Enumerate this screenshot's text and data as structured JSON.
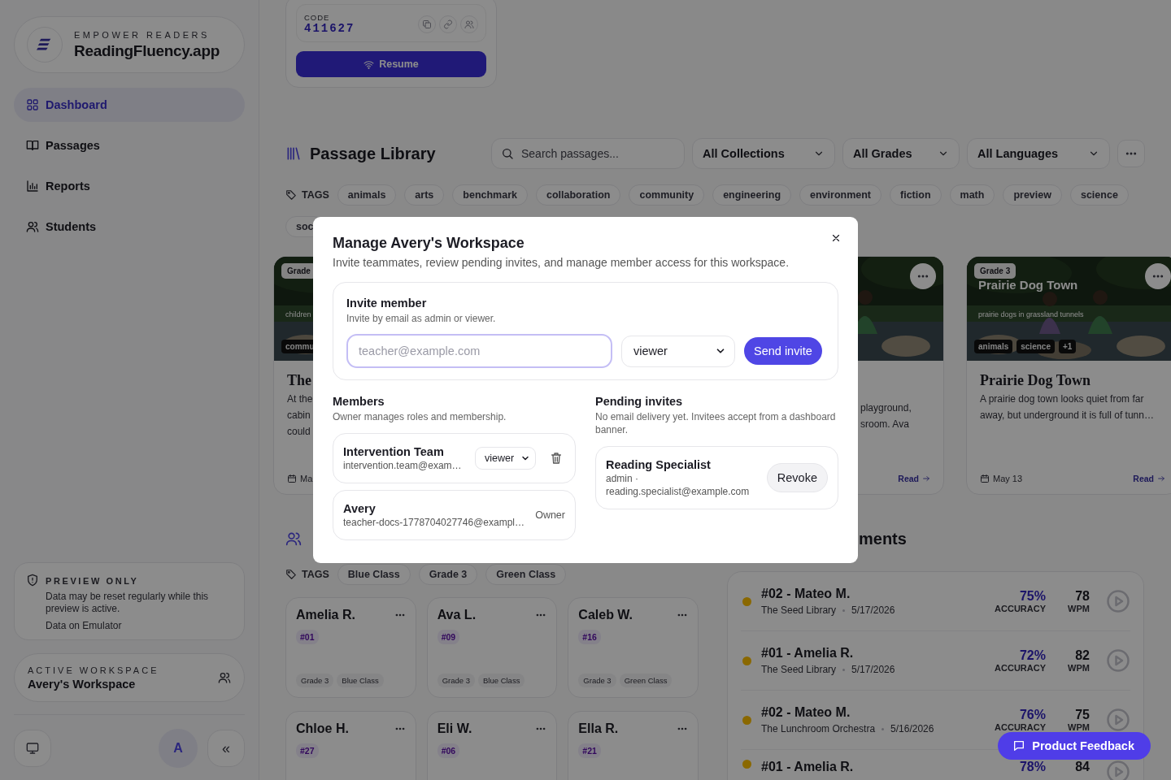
{
  "sidebar": {
    "brand_tagline": "EMPOWER READERS",
    "brand_name": "ReadingFluency.app",
    "nav": [
      {
        "label": "Dashboard",
        "selected": true
      },
      {
        "label": "Passages",
        "selected": false
      },
      {
        "label": "Reports",
        "selected": false
      },
      {
        "label": "Students",
        "selected": false
      }
    ],
    "preview_notice": {
      "title": "PREVIEW ONLY",
      "text": "Data may be reset regularly while this preview is active.",
      "source": "Data on Emulator"
    },
    "workspace": {
      "label": "ACTIVE WORKSPACE",
      "name": "Avery's Workspace"
    },
    "avatar": "A",
    "collapse": "«"
  },
  "session_card": {
    "code_label": "CODE",
    "code": "411627",
    "resume": "Resume"
  },
  "passage_library": {
    "title": "Passage Library",
    "search_placeholder": "Search passages...",
    "filters": [
      "All Collections",
      "All Grades",
      "All Languages"
    ],
    "tags_label": "TAGS",
    "tags": [
      "animals",
      "arts",
      "benchmark",
      "collaboration",
      "community",
      "engineering",
      "environment",
      "fiction",
      "math",
      "preview",
      "science",
      "soc"
    ],
    "cards": [
      {
        "grade": "Grade",
        "cover_subtitle": "children",
        "cover_tags": [
          "commu"
        ],
        "title": "The",
        "description_lines": [
          "At the",
          "cabin",
          "could"
        ],
        "date": "Ma",
        "more": false
      },
      {
        "description_lines": [
          "playground,",
          "sroom. Ava"
        ],
        "action": "Read",
        "more": true
      },
      {
        "grade": "Grade 3",
        "cover_title": "Prairie Dog Town",
        "cover_subtitle": "prairie dogs in grassland tunnels",
        "cover_tags": [
          "animals",
          "science",
          "+1"
        ],
        "title": "Prairie Dog Town",
        "description": "A prairie dog town looks quiet from far away, but underground it is full of tunn…",
        "date": "May 13",
        "action": "Read",
        "more": true
      }
    ]
  },
  "students": {
    "tags_label": "TAGS",
    "tags": [
      "Blue Class",
      "Grade 3",
      "Green Class"
    ],
    "cards": [
      {
        "name": "Amelia R.",
        "number": "#01",
        "chips": [
          "Grade 3",
          "Blue Class"
        ]
      },
      {
        "name": "Ava L.",
        "number": "#09",
        "chips": [
          "Grade 3",
          "Blue Class"
        ]
      },
      {
        "name": "Caleb W.",
        "number": "#16",
        "chips": [
          "Grade 3",
          "Green Class"
        ]
      },
      {
        "name": "Chloe H.",
        "number": "#27"
      },
      {
        "name": "Eli W.",
        "number": "#06"
      },
      {
        "name": "Ella R.",
        "number": "#21"
      }
    ]
  },
  "assessments": {
    "title": "ments",
    "rows": [
      {
        "title": "#02 - Mateo M.",
        "passage": "The Seed Library",
        "date": "5/17/2026",
        "accuracy": "75%",
        "accuracy_label": "ACCURACY",
        "wpm": "78",
        "wpm_label": "WPM",
        "color": "#8a6800"
      },
      {
        "title": "#01 - Amelia R.",
        "passage": "The Seed Library",
        "date": "5/17/2026",
        "accuracy": "72%",
        "accuracy_label": "ACCURACY",
        "wpm": "82",
        "wpm_label": "WPM",
        "color": "#8a6800"
      },
      {
        "title": "#02 - Mateo M.",
        "passage": "The Lunchroom Orchestra",
        "date": "5/16/2026",
        "accuracy": "76%",
        "accuracy_label": "ACCURACY",
        "wpm": "75",
        "wpm_label": "WPM",
        "color": "#8a6800"
      },
      {
        "title": "#01 - Amelia R.",
        "accuracy": "78%",
        "wpm": "84",
        "color": "#8a6800"
      }
    ]
  },
  "modal": {
    "title": "Manage Avery's Workspace",
    "subtitle": "Invite teammates, review pending invites, and manage member access for this workspace.",
    "invite": {
      "title": "Invite member",
      "hint": "Invite by email as admin or viewer.",
      "email_placeholder": "teacher@example.com",
      "role": "viewer",
      "button": "Send invite"
    },
    "members": {
      "title": "Members",
      "hint": "Owner manages roles and membership.",
      "items": [
        {
          "kind": "editable",
          "name": "Intervention Team",
          "email": "intervention.team@exam…",
          "role": "viewer"
        },
        {
          "kind": "owner",
          "name": "Avery",
          "email": "teacher-docs-1778704027746@exampl…",
          "role": "Owner"
        }
      ]
    },
    "pending": {
      "title": "Pending invites",
      "hint": "No email delivery yet. Invitees accept from a dashboard banner.",
      "items": [
        {
          "name": "Reading Specialist",
          "role": "admin ·",
          "email": "reading.specialist@example.com",
          "button": "Revoke"
        }
      ]
    }
  },
  "feedback_button": "Product Feedback"
}
